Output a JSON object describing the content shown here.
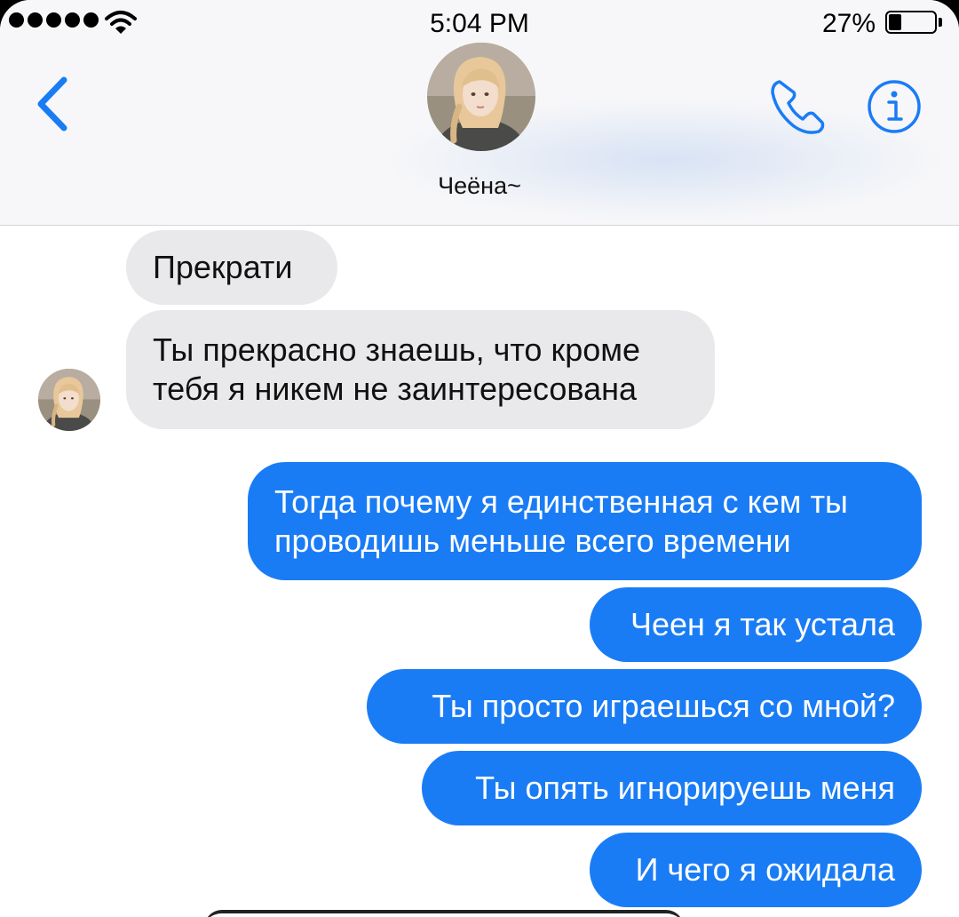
{
  "status_bar": {
    "time": "5:04 PM",
    "battery_percent_text": "27%",
    "battery_level": 0.27,
    "signal_bars": 5
  },
  "header": {
    "contact_name": "Чеёна~",
    "back_icon": "chevron-left-icon",
    "call_icon": "phone-icon",
    "info_icon": "info-icon"
  },
  "colors": {
    "sent_bubble": "#1a7cf5",
    "received_bubble": "#e9e9eb",
    "accent": "#1a7cf5"
  },
  "messages": [
    {
      "direction": "received",
      "text": "Прекрати"
    },
    {
      "direction": "received",
      "lines": [
        "Ты прекрасно знаешь, что кроме",
        "тебя я никем не заинтересована"
      ]
    },
    {
      "direction": "sent",
      "lines": [
        "Тогда почему я единственная с кем ты",
        "проводишь меньше всего времени"
      ]
    },
    {
      "direction": "sent",
      "text": "Чеен я так устала"
    },
    {
      "direction": "sent",
      "text": "Ты просто играешься со мной?"
    },
    {
      "direction": "sent",
      "text": "Ты опять игнорируешь меня"
    },
    {
      "direction": "sent",
      "text": "И чего я ожидала"
    }
  ]
}
